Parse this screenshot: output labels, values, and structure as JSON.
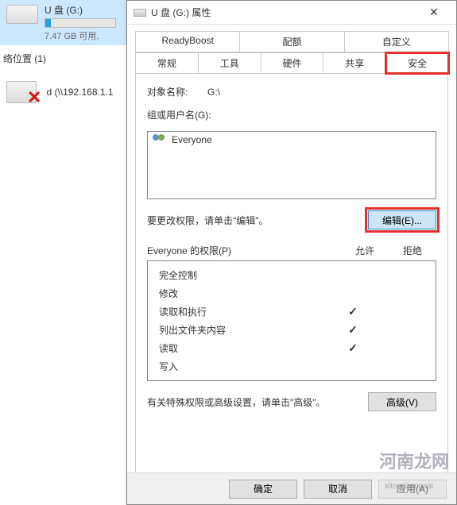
{
  "explorer": {
    "drive": {
      "name": "U 盘 (G:)",
      "free": "7.47 GB 可用,",
      "fill_pct": 8
    },
    "net_header": "络位置 (1)",
    "net_item": "d (\\\\192.168.1.1"
  },
  "dialog": {
    "title": "U 盘 (G:) 属性",
    "tabs_top": [
      "ReadyBoost",
      "配额",
      "自定义"
    ],
    "tabs_bottom": [
      "常规",
      "工具",
      "硬件",
      "共享",
      "安全"
    ],
    "active_tab": "安全",
    "object_label": "对象名称:",
    "object_value": "G:\\",
    "group_label": "组或用户名(G):",
    "group_items": [
      "Everyone"
    ],
    "edit_hint": "要更改权限，请单击\"编辑\"。",
    "edit_btn": "编辑(E)...",
    "perm_header": {
      "name": "Everyone 的权限(P)",
      "allow": "允许",
      "deny": "拒绝"
    },
    "permissions": [
      {
        "name": "完全控制",
        "allow": false,
        "deny": false
      },
      {
        "name": "修改",
        "allow": false,
        "deny": false
      },
      {
        "name": "读取和执行",
        "allow": true,
        "deny": false
      },
      {
        "name": "列出文件夹内容",
        "allow": true,
        "deny": false
      },
      {
        "name": "读取",
        "allow": true,
        "deny": false
      },
      {
        "name": "写入",
        "allow": false,
        "deny": false
      }
    ],
    "adv_hint": "有关特殊权限或高级设置，请单击\"高级\"。",
    "adv_btn": "高级(V)",
    "ok": "确定",
    "cancel": "取消",
    "apply": "应用(A)"
  },
  "watermark": {
    "main": "河南龙网",
    "sub": "xitongzongcai"
  }
}
